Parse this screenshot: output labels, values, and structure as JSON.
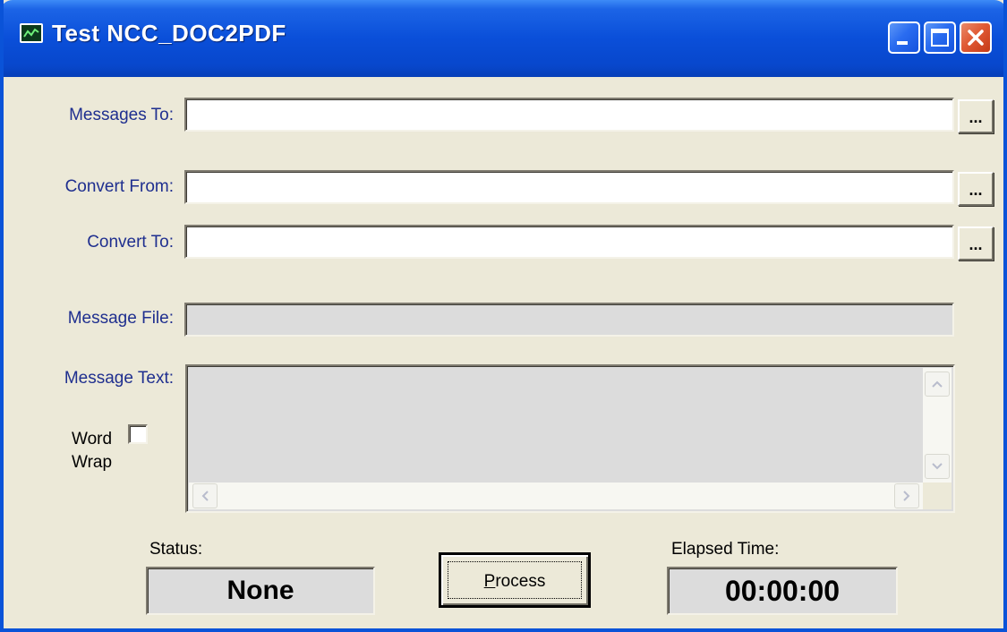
{
  "window": {
    "title": "Test NCC_DOC2PDF",
    "title_buttons": [
      "minimize",
      "maximize",
      "close"
    ]
  },
  "fields": {
    "messages_to": {
      "label": "Messages To:",
      "value": "",
      "browse": "..."
    },
    "convert_from": {
      "label": "Convert From:",
      "value": "",
      "browse": "..."
    },
    "convert_to": {
      "label": "Convert To:",
      "value": "",
      "browse": "..."
    },
    "message_file": {
      "label": "Message File:",
      "value": ""
    },
    "message_text": {
      "label": "Message Text:",
      "value": ""
    }
  },
  "word_wrap": {
    "label_line1": "Word",
    "label_line2": "Wrap",
    "checked": false
  },
  "status": {
    "label": "Status:",
    "value": "None"
  },
  "process": {
    "label_first": "P",
    "label_rest": "rocess"
  },
  "elapsed": {
    "label": "Elapsed Time:",
    "value": "00:00:00"
  },
  "colors": {
    "titlebar": "#0a4fd9",
    "face": "#ece9d8",
    "label_text": "#1f2f8f",
    "close": "#e05a35"
  },
  "icons": [
    "app-icon",
    "minimize-icon",
    "maximize-icon",
    "close-icon",
    "scroll-up-icon",
    "scroll-down-icon",
    "scroll-left-icon",
    "scroll-right-icon"
  ]
}
